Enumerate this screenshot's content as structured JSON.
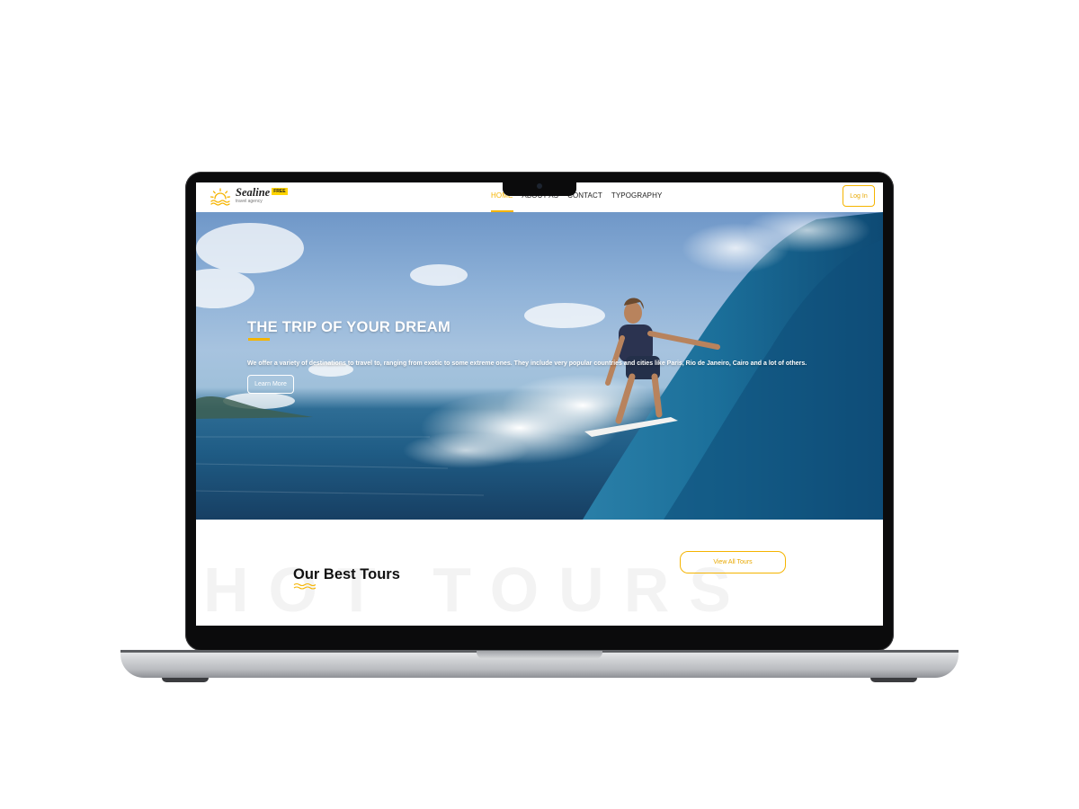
{
  "brand": {
    "name": "Sealine",
    "tagline": "travel agency",
    "badge": "FREE",
    "accent_color": "#f5b400"
  },
  "nav": {
    "items": [
      {
        "label": "HOME",
        "active": true
      },
      {
        "label": "ABOUT AS",
        "active": false
      },
      {
        "label": "CONTACT",
        "active": false
      },
      {
        "label": "TYPOGRAPHY",
        "active": false
      }
    ],
    "login_label": "Log In"
  },
  "hero": {
    "title": "THE TRIP OF YOUR DREAM",
    "description": "We offer a variety of destinations to travel to, ranging from exotic to some extreme ones. They include very popular countries and cities like Paris, Rio de Janeiro, Cairo and a lot of others.",
    "button_label": "Learn More"
  },
  "tours": {
    "background_word": "HOT TOURS",
    "title": "Our Best Tours",
    "view_all_label": "View All Tours"
  },
  "icons": {
    "logo": "sun-waves-icon",
    "divider": "wavy-lines-icon"
  }
}
